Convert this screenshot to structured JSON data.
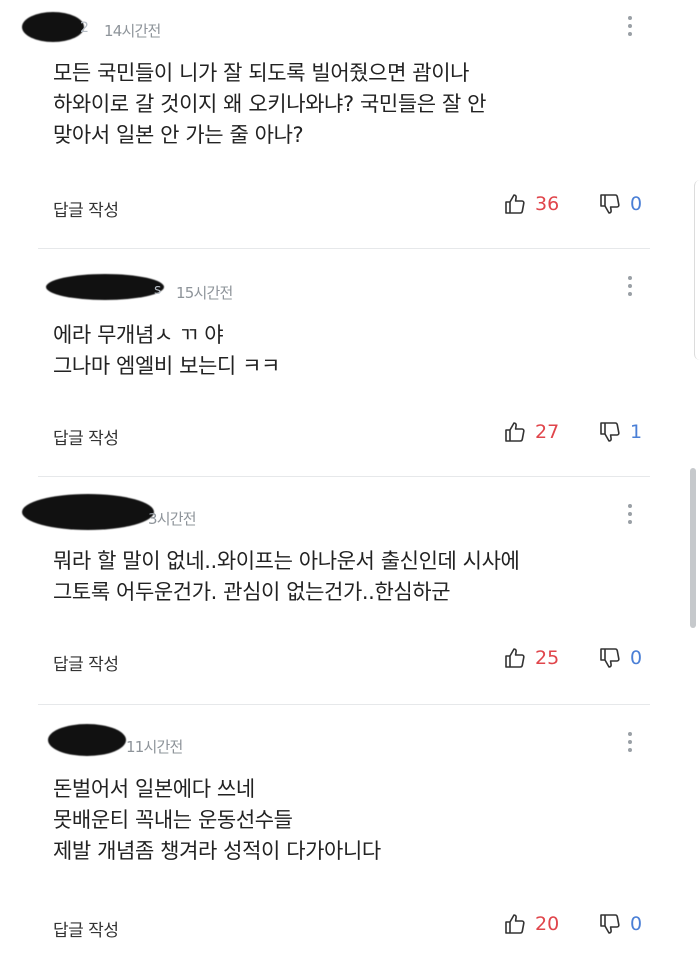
{
  "comments": [
    {
      "author_visible_suffix": "2",
      "timestamp": "14시간전",
      "text": "모든 국민들이 니가 잘 되도록 빌어줬으면 괌이나\n하와이로 갈 것이지 왜 오키나와냐? 국민들은 잘 안\n맞아서 일본 안 가는 줄 아나?",
      "reply_label": "답글 작성",
      "likes": "36",
      "dislikes": "0"
    },
    {
      "author_visible_suffix": "s",
      "timestamp": "15시간전",
      "text": "에라 무개념ㅅ ㄲ 야\n그나마 엠엘비 보는디 ㅋㅋ",
      "reply_label": "답글 작성",
      "likes": "27",
      "dislikes": "1"
    },
    {
      "author_visible_suffix": "",
      "timestamp": "3시간전",
      "text": "뭐라 할 말이 없네..와이프는 아나운서 출신인데 시사에\n그토록 어두운건가. 관심이 없는건가..한심하군",
      "reply_label": "답글 작성",
      "likes": "25",
      "dislikes": "0"
    },
    {
      "author_visible_suffix": "",
      "timestamp": "11시간전",
      "text": "돈벌어서 일본에다  쓰네\n못배운티 꼭내는 운동선수들\n제발 개념좀  챙겨라 성적이 다가아니다",
      "reply_label": "답글 작성",
      "likes": "20",
      "dislikes": "0"
    }
  ],
  "icons": {
    "more": "more-vertical-icon",
    "like": "thumbs-up-icon",
    "dislike": "thumbs-down-icon"
  },
  "colors": {
    "like": "#e0454b",
    "dislike": "#4a7fd6",
    "timestamp": "#8e949a",
    "text": "#222222"
  }
}
